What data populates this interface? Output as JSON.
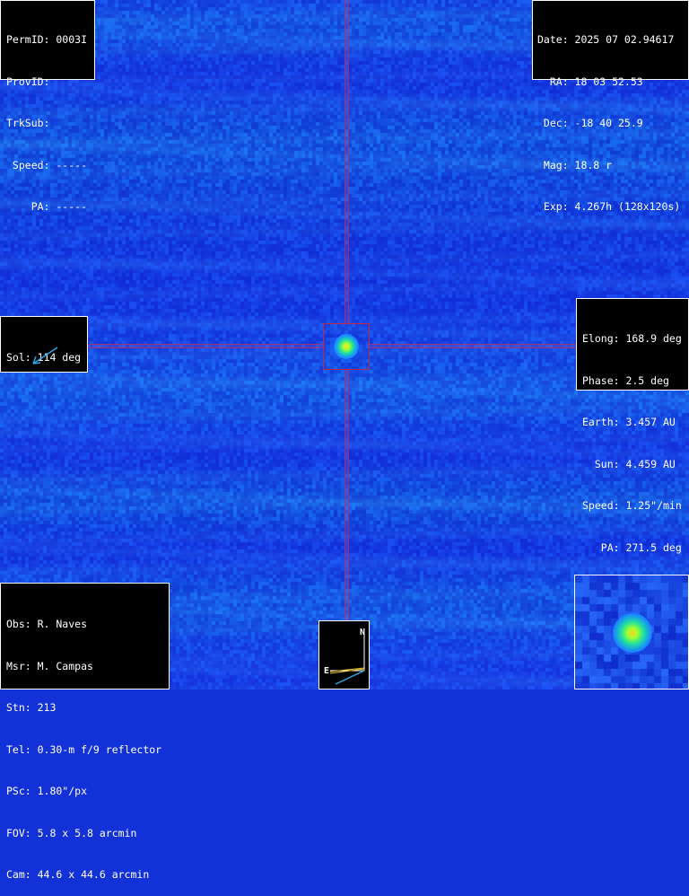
{
  "top_left": {
    "lines": [
      "PermID: 0003I",
      "ProvID:",
      "TrkSub:",
      " Speed: -----",
      "    PA: -----"
    ]
  },
  "top_right": {
    "lines": [
      "Date: 2025 07 02.94617",
      "  RA: 18 03 52.53",
      " Dec: -18 40 25.9",
      " Mag: 18.8 r",
      " Exp: 4.267h (128x120s)"
    ]
  },
  "sol": {
    "label": "Sol: 114 deg"
  },
  "geometry_panel": {
    "lines": [
      "Elong: 168.9 deg",
      "Phase: 2.5 deg",
      "Earth: 3.457 AU",
      "  Sun: 4.459 AU",
      "Speed: 1.25\"/min",
      "   PA: 271.5 deg"
    ]
  },
  "observer": {
    "lines": [
      "Obs: R. Naves",
      "Msr: M. Campas",
      "Stn: 213",
      "Tel: 0.30-m f/9 reflector",
      "PSc: 1.80\"/px",
      "FOV: 5.8 x 5.8 arcmin",
      "Cam: 44.6 x 44.6 arcmin"
    ]
  },
  "compass": {
    "north": "N",
    "east": "E"
  },
  "colors": {
    "crosshair": "#c8285a",
    "sky": "#1232d8",
    "sun_arrow": "#2aa8e8",
    "motion_arrow": "#e8c040"
  }
}
